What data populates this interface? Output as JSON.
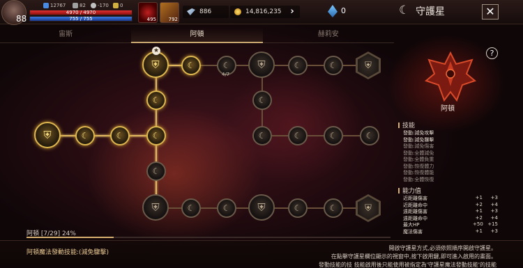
{
  "header": {
    "level": "88",
    "stats": [
      "12767",
      "82",
      "-170",
      "0"
    ],
    "hp": "4970 / 4970",
    "hp_fraction": 1.0,
    "mp": "755 / 755",
    "mp_fraction": 1.0,
    "potion_count": "495",
    "quill_count": "792",
    "currency_a": "886",
    "currency_b": "14,816,235",
    "gems": "0",
    "title": "守護星",
    "close": "✕"
  },
  "tabs": [
    {
      "label": "宙斯"
    },
    {
      "label": "阿頓"
    },
    {
      "label": "赫莉安"
    }
  ],
  "map": {
    "node_counter": "4/7",
    "progress_label": "阿頓 [7/29] 24%",
    "progress_fraction": 0.24
  },
  "panel": {
    "help": "?",
    "emblem_name": "阿頓",
    "skills_title": "技能",
    "skills": [
      {
        "label": "發動:減免攻擊",
        "on": true
      },
      {
        "label": "發動:減免驟擊",
        "on": true
      },
      {
        "label": "發動:減免傷害",
        "on": false
      },
      {
        "label": "發動:全體減免",
        "on": false
      },
      {
        "label": "發動:全體負重",
        "on": false
      },
      {
        "label": "發動:恢復體力",
        "on": false
      },
      {
        "label": "發動:恢復體能",
        "on": false
      },
      {
        "label": "發動:全體恢復",
        "on": false
      }
    ],
    "abilities_title": "能力值",
    "abilities": [
      {
        "label": "近距離傷害",
        "a": "+1",
        "b": "+3"
      },
      {
        "label": "近距離命中",
        "a": "+2",
        "b": "+4"
      },
      {
        "label": "遠距離傷害",
        "a": "+1",
        "b": "+3"
      },
      {
        "label": "遠距離命中",
        "a": "+2",
        "b": "+4"
      },
      {
        "label": "最大HP",
        "a": "+50",
        "b": "+15"
      },
      {
        "label": "魔法傷害",
        "a": "+1",
        "b": "+3"
      }
    ]
  },
  "footer": {
    "auto_skill": "阿頓魔法發動技能:(減免驟擊)",
    "desc_lines": [
      "開啟守護星方式,必須依照順序開啟守護星。",
      "在點擊守護星欄位顯示的視窗中,按下啟用鍵,即可進入啟用的畫面。",
      "發動技能的技 技能啟用後只能使用被指定為'守護星魔法發動技能'的技能"
    ]
  },
  "colors": {
    "accent": "#e0b860",
    "hp": "#e03030",
    "mp": "#3a7ae0"
  }
}
